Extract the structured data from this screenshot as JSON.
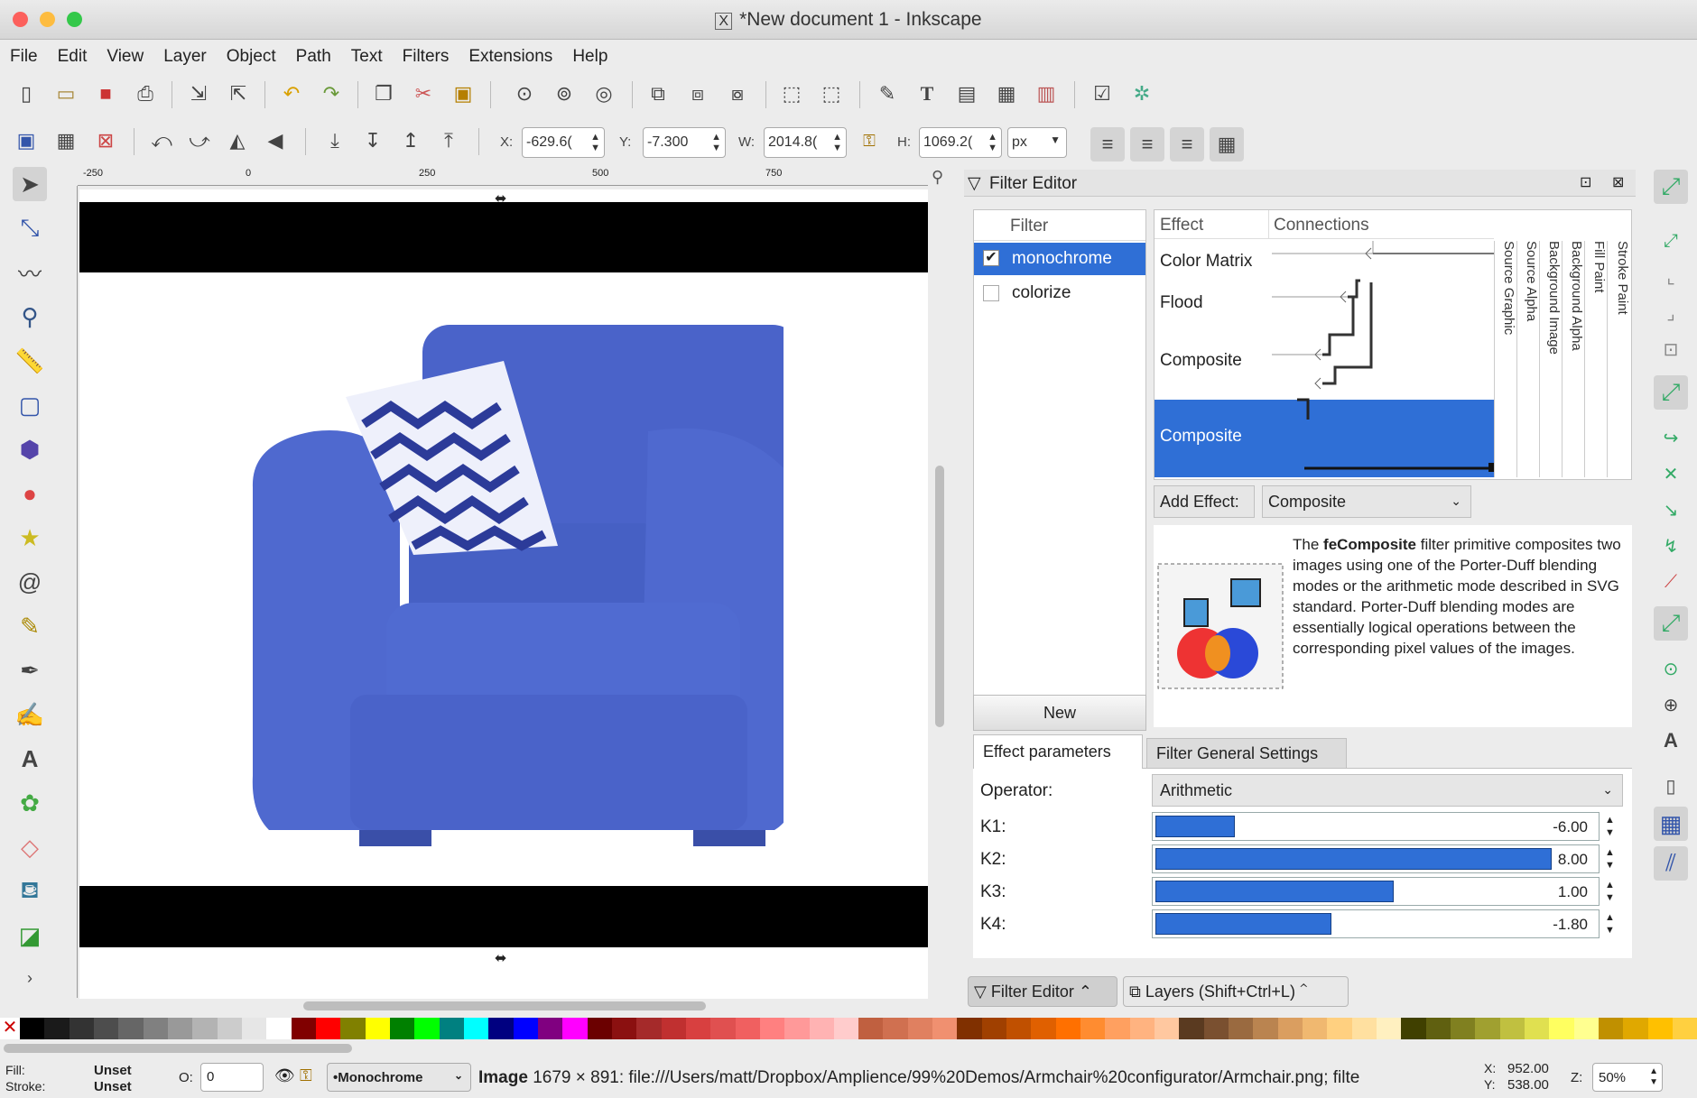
{
  "window": {
    "title": "*New document 1 - Inkscape",
    "app_icon": "X"
  },
  "menu": [
    "File",
    "Edit",
    "View",
    "Layer",
    "Object",
    "Path",
    "Text",
    "Filters",
    "Extensions",
    "Help"
  ],
  "toolbar2": {
    "x_label": "X:",
    "x_value": "-629.6(",
    "y_label": "Y:",
    "y_value": "-7.300",
    "w_label": "W:",
    "w_value": "2014.8(",
    "h_label": "H:",
    "h_value": "1069.2(",
    "unit": "px"
  },
  "ruler": {
    "ticks": [
      "-250",
      "0",
      "250",
      "500",
      "750"
    ]
  },
  "filter_editor": {
    "title": "Filter Editor",
    "filter_col": "Filter",
    "filters": [
      {
        "name": "monochrome",
        "checked": true,
        "selected": true
      },
      {
        "name": "colorize",
        "checked": false,
        "selected": false
      }
    ],
    "new_button": "New",
    "effect_col": "Effect",
    "connections_col": "Connections",
    "effects": [
      "Color Matrix",
      "Flood",
      "Composite",
      "Composite"
    ],
    "selected_effect_index": 3,
    "inputs": [
      "Source Graphic",
      "Source Alpha",
      "Background Image",
      "Background Alpha",
      "Fill Paint",
      "Stroke Paint"
    ],
    "add_effect_label": "Add Effect:",
    "add_effect_value": "Composite",
    "description_name": "feComposite",
    "description_pre": "The ",
    "description_post": " filter primitive composites two images using one of the Porter-Duff blending modes or the arithmetic mode described in SVG standard. Porter-Duff blending modes are essentially logical operations between the corresponding pixel values of the images.",
    "tabs": [
      "Effect parameters",
      "Filter General Settings"
    ],
    "operator_label": "Operator:",
    "operator_value": "Arithmetic",
    "params": [
      {
        "label": "K1:",
        "value": "-6.00",
        "fraction": 0.18
      },
      {
        "label": "K2:",
        "value": "8.00",
        "fraction": 0.9
      },
      {
        "label": "K3:",
        "value": "1.00",
        "fraction": 0.54
      },
      {
        "label": "K4:",
        "value": "-1.80",
        "fraction": 0.4
      }
    ],
    "dock_tabs": [
      "Filter Editor",
      "Layers (Shift+Ctrl+L)"
    ]
  },
  "status": {
    "fill_label": "Fill:",
    "fill_value": "Unset",
    "stroke_label": "Stroke:",
    "stroke_value": "Unset",
    "opacity_label": "O:",
    "opacity_value": "0",
    "layer_value": "•Monochrome",
    "message_bold": "Image",
    "message": " 1679 × 891: file:///Users/matt/Dropbox/Amplience/99%20Demos/Armchair%20configurator/Armchair.png; filte",
    "x_label": "X:",
    "x_value": "952.00",
    "y_label": "Y:",
    "y_value": "538.00",
    "zoom_label": "Z:",
    "zoom_value": "50%"
  },
  "colors": {
    "accent": "#2f6fd6",
    "sofa": "#4a63c9"
  }
}
